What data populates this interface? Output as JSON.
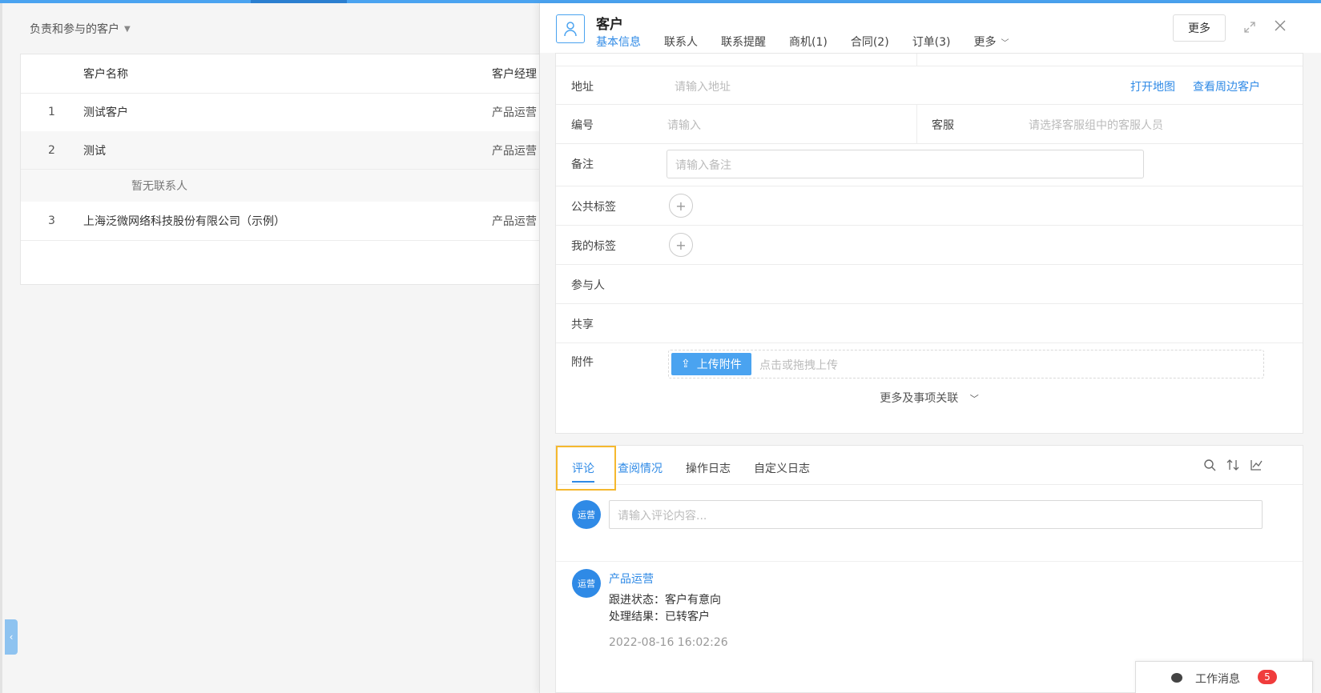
{
  "left": {
    "filter_label": "负责和参与的客户",
    "columns": {
      "name": "客户名称",
      "manager": "客户经理"
    },
    "rows": [
      {
        "num": "1",
        "name": "测试客户",
        "manager": "产品运营"
      },
      {
        "num": "2",
        "name": "测试",
        "manager": "产品运营"
      },
      {
        "num": "3",
        "name": "上海泛微网络科技股份有限公司（示例）",
        "manager": "产品运营"
      }
    ],
    "no_contact": "暂无联系人"
  },
  "drawer": {
    "title": "客户",
    "more_button": "更多",
    "tabs": [
      {
        "label": "基本信息"
      },
      {
        "label": "联系人"
      },
      {
        "label": "联系提醒"
      },
      {
        "label": "商机(1)"
      },
      {
        "label": "合同(2)"
      },
      {
        "label": "订单(3)"
      },
      {
        "label": "更多"
      }
    ],
    "form": {
      "address_label": "地址",
      "address_placeholder": "请输入地址",
      "open_map": "打开地图",
      "nearby": "查看周边客户",
      "code_label": "编号",
      "code_placeholder": "请输入",
      "service_label": "客服",
      "service_placeholder": "请选择客服组中的客服人员",
      "remark_label": "备注",
      "remark_placeholder": "请输入备注",
      "public_tags_label": "公共标签",
      "my_tags_label": "我的标签",
      "participants_label": "参与人",
      "share_label": "共享",
      "attachment_label": "附件",
      "upload_button": "上传附件",
      "upload_hint": "点击或拖拽上传",
      "more_assoc": "更多及事项关联"
    },
    "comments": {
      "tabs": [
        "评论",
        "查阅情况",
        "操作日志",
        "自定义日志"
      ],
      "avatar_text": "运营",
      "input_placeholder": "请输入评论内容...",
      "items": [
        {
          "author": "产品运营",
          "lines": [
            "跟进状态：客户有意向",
            "处理结果：已转客户"
          ],
          "time": "2022-08-16 16:02:26"
        }
      ]
    }
  },
  "work_msg": {
    "label": "工作消息",
    "count": "5"
  },
  "colors": {
    "accent": "#2f8ae6",
    "highlight": "#f5b82e",
    "badge": "#f03c3c"
  }
}
